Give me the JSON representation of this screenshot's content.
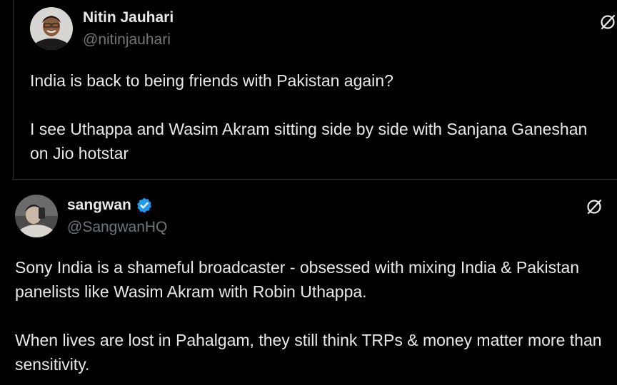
{
  "colors": {
    "background": "#000000",
    "text": "#e7e9ea",
    "muted": "#71767b",
    "divider": "#2f3336",
    "verified": "#1d9bf0"
  },
  "tweets": [
    {
      "author": {
        "name": "Nitin Jauhari",
        "handle": "@nitinjauhari",
        "verified": false
      },
      "paragraphs": [
        "India is back to being friends with Pakistan again?",
        "I see Uthappa and Wasim Akram sitting side by side with Sanjana Ganeshan on Jio hotstar"
      ],
      "icon": "grok-icon"
    },
    {
      "author": {
        "name": "sangwan",
        "handle": "@SangwanHQ",
        "verified": true
      },
      "paragraphs": [
        "Sony India is a shameful broadcaster - obsessed with mixing India & Pakistan panelists like Wasim Akram with Robin Uthappa.",
        "When lives are lost in Pahalgam, they still think TRPs & money matter more than sensitivity."
      ],
      "icon": "grok-icon"
    }
  ]
}
